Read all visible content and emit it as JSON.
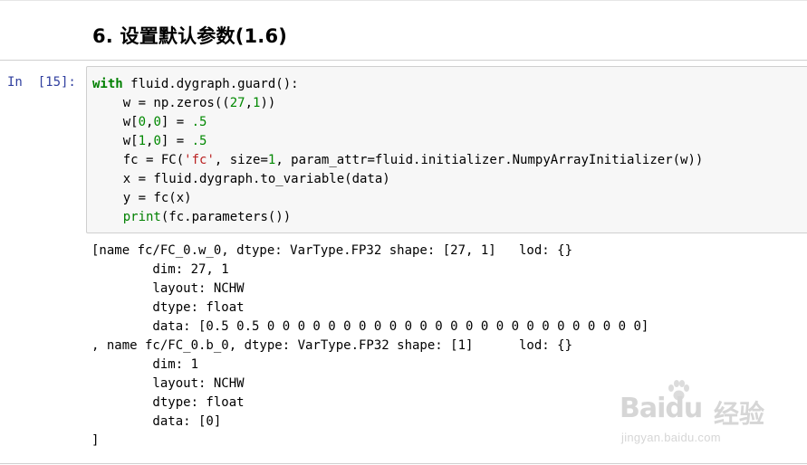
{
  "section": {
    "title": "6. 设置默认参数(1.6)"
  },
  "cell": {
    "prompt": "In  [15]:",
    "code": {
      "l1_kw": "with",
      "l1_rest": " fluid.dygraph.guard():",
      "l2_a": "    w = np.zeros((",
      "l2_n1": "27",
      "l2_b": ",",
      "l2_n2": "1",
      "l2_c": "))",
      "l3_a": "    w[",
      "l3_n1": "0",
      "l3_b": ",",
      "l3_n2": "0",
      "l3_c": "] = ",
      "l3_n3": ".5",
      "l4_a": "    w[",
      "l4_n1": "1",
      "l4_b": ",",
      "l4_n2": "0",
      "l4_c": "] = ",
      "l4_n3": ".5",
      "l5_a": "    fc = FC(",
      "l5_s": "'fc'",
      "l5_b": ", size=",
      "l5_n": "1",
      "l5_c": ", param_attr=fluid.initializer.NumpyArrayInitializer(w))",
      "l6": "    x = fluid.dygraph.to_variable(data)",
      "l7": "    y = fc(x)",
      "l8_indent": "    ",
      "l8_kw": "print",
      "l8_rest": "(fc.parameters())"
    }
  },
  "output": {
    "lines": [
      "[name fc/FC_0.w_0, dtype: VarType.FP32 shape: [27, 1]   lod: {}",
      "        dim: 27, 1",
      "        layout: NCHW",
      "        dtype: float",
      "        data: [0.5 0.5 0 0 0 0 0 0 0 0 0 0 0 0 0 0 0 0 0 0 0 0 0 0 0 0 0]",
      ", name fc/FC_0.b_0, dtype: VarType.FP32 shape: [1]      lod: {}",
      "        dim: 1",
      "        layout: NCHW",
      "        dtype: float",
      "        data: [0]",
      "]"
    ]
  },
  "watermark": {
    "brand": "Baidu",
    "cn": "经验",
    "url": "jingyan.baidu.com"
  },
  "colors": {
    "keyword": "#008000",
    "number": "#008800",
    "string": "#ba2121",
    "prompt": "#303f9f",
    "cell_bg": "#f7f7f7"
  }
}
